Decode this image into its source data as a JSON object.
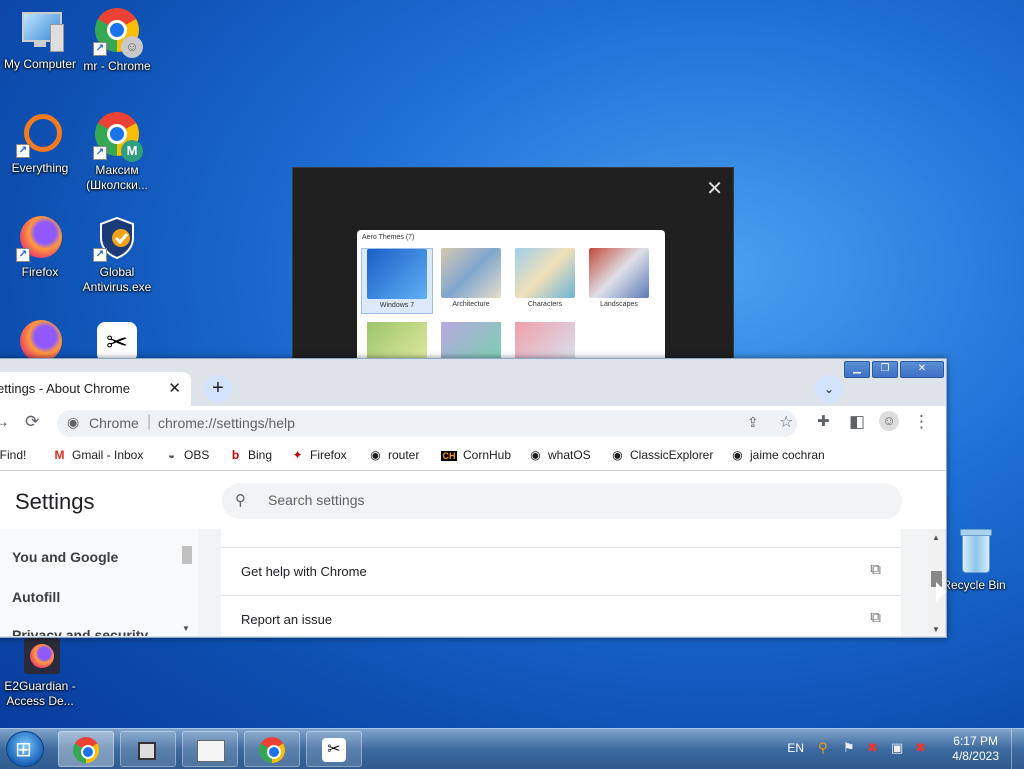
{
  "desktop": {
    "icons": [
      {
        "label": "My Computer",
        "icon": "computer-icon"
      },
      {
        "label": "mr - Chrome",
        "icon": "chrome-icon"
      },
      {
        "label": "Everything",
        "icon": "everything-icon"
      },
      {
        "label": "Максим (Школски...",
        "icon": "chrome-icon",
        "badge": "M"
      },
      {
        "label": "Firefox",
        "icon": "firefox-icon"
      },
      {
        "label": "Global Antivirus.exe",
        "icon": "shield-icon"
      },
      {
        "label": "E2Guardian - Access De...",
        "icon": "firefox-icon"
      },
      {
        "label": "Recycle Bin",
        "icon": "recycle-bin-icon"
      }
    ]
  },
  "dialog": {
    "close_glyph": "✕",
    "themes_title": "Aero Themes (7)",
    "themes": [
      "Windows 7",
      "Architecture",
      "Characters",
      "Landscapes"
    ]
  },
  "chrome": {
    "window_controls": {
      "minimize": "▁",
      "maximize": "❐",
      "close": "✕"
    },
    "tab": {
      "title": "ettings - About Chrome",
      "close": "✕"
    },
    "new_tab": "+",
    "tab_search": "⌄",
    "toolbar": {
      "reload": "⟳",
      "site_label": "Chrome",
      "url": "chrome://settings/help",
      "share": "⇪",
      "star": "☆",
      "extensions": "✚",
      "sidepanel": "◧",
      "menu": "⋮"
    },
    "bookmarks": [
      {
        "label": "gFind!",
        "icon": ""
      },
      {
        "label": "Gmail - Inbox",
        "icon": "M"
      },
      {
        "label": "OBS",
        "icon": "◒"
      },
      {
        "label": "Bing",
        "icon": "b"
      },
      {
        "label": "Firefox",
        "icon": "✦"
      },
      {
        "label": "router",
        "icon": "◉"
      },
      {
        "label": "CornHub",
        "icon": "CH"
      },
      {
        "label": "whatOS",
        "icon": "◉"
      },
      {
        "label": "ClassicExplorer",
        "icon": "◉"
      },
      {
        "label": "jaime cochran",
        "icon": "◉"
      }
    ],
    "settings": {
      "title": "Settings",
      "search_placeholder": "Search settings",
      "sidebar": [
        "You and Google",
        "Autofill",
        "Privacy and security"
      ],
      "rows": [
        {
          "label": "Get help with Chrome",
          "icon": "⧉"
        },
        {
          "label": "Report an issue",
          "icon": "⧉"
        }
      ]
    }
  },
  "taskbar": {
    "language": "EN",
    "time": "6:17 PM",
    "date": "4/8/2023"
  }
}
